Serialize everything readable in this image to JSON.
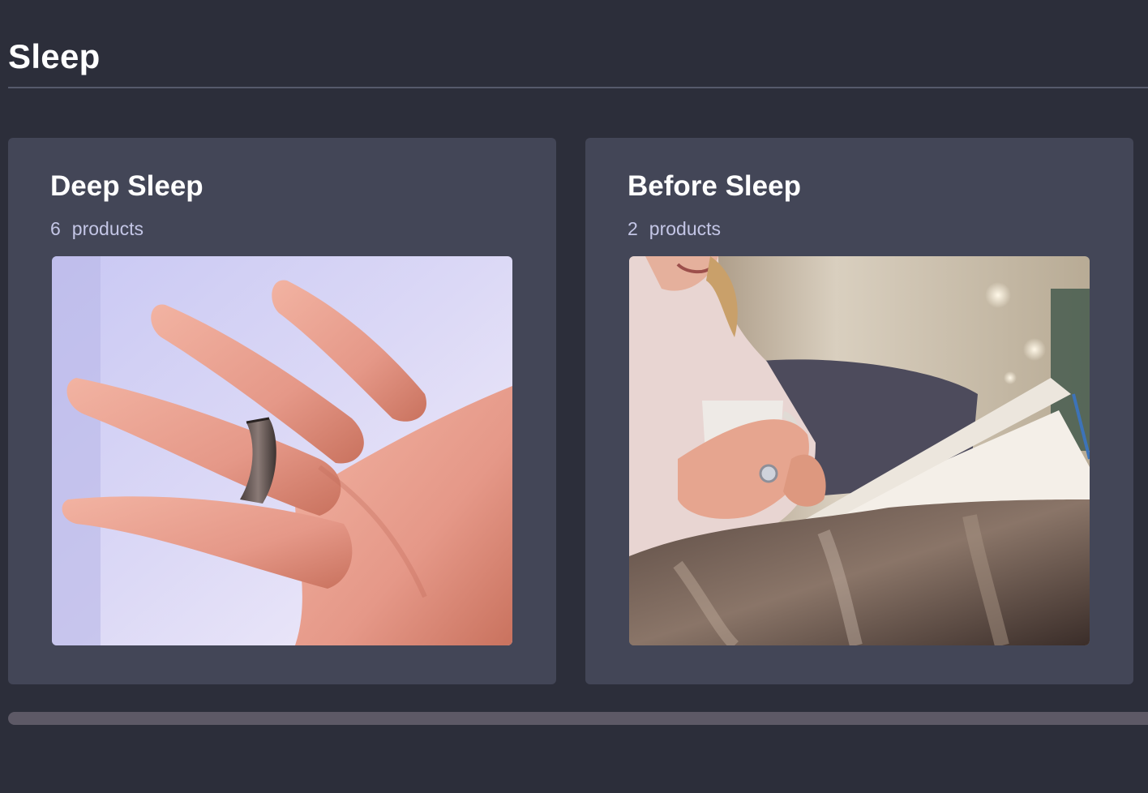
{
  "section": {
    "title": "Sleep"
  },
  "cards": [
    {
      "title": "Deep Sleep",
      "count": "6",
      "count_label": "products",
      "image_alt": "hand wearing a smart ring"
    },
    {
      "title": "Before Sleep",
      "count": "2",
      "count_label": "products",
      "image_alt": "woman with a mug reading a book under a blanket"
    }
  ],
  "colors": {
    "background": "#2c2e3a",
    "card": "#434657",
    "title": "#ffffff",
    "count": "#c4c6e6",
    "scrollbar": "#5d5966"
  }
}
